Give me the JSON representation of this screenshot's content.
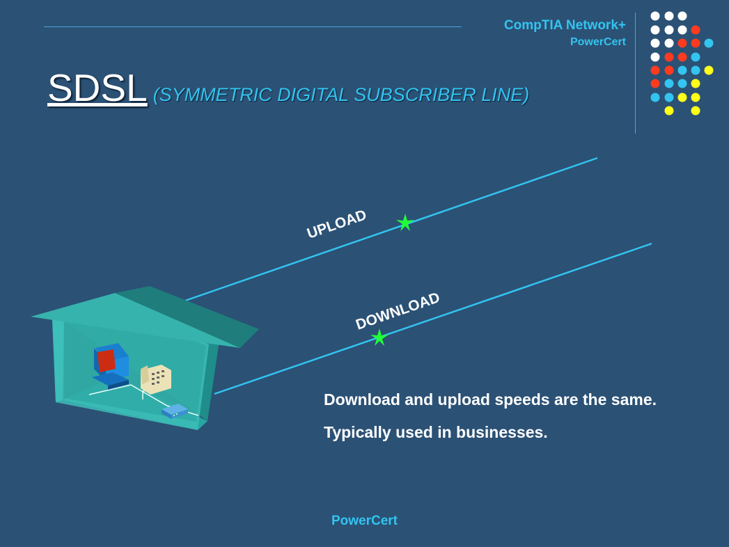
{
  "header": {
    "brand_line1": "CompTIA Network+",
    "brand_line2": "PowerCert"
  },
  "title": {
    "main": "SDSL",
    "subtitle": "(SYMMETRIC DIGITAL SUBSCRIBER LINE)"
  },
  "diagram": {
    "upload_label": "UPLOAD",
    "download_label": "DOWNLOAD"
  },
  "body": {
    "point1": "Download and upload speeds are the same.",
    "point2": "Typically used in businesses."
  },
  "footer": {
    "brand": "PowerCert"
  },
  "colors": {
    "background": "#2b5175",
    "accent": "#33c4f0",
    "dot_red": "#ff3b1f",
    "dot_yellow": "#ffff1a",
    "dot_white": "#ffffff"
  }
}
